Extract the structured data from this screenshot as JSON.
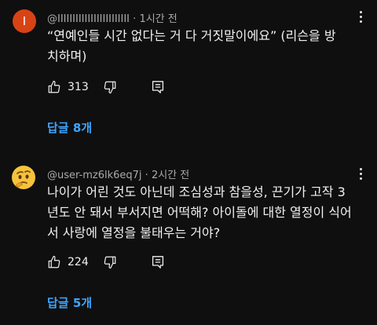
{
  "comments": [
    {
      "avatar_letter": "I",
      "avatar_color": "#d84315",
      "username": "@IIIIIIIIIIIIIIIIIIIIIIII",
      "separator": "·",
      "time": "1시간 전",
      "text_line1": "“연예인들 시간 없다는 거 다 거짓말이에요”   (리슨을 방",
      "text_line2": "치하며)",
      "likes": "313",
      "replies_label": "답글 8개"
    },
    {
      "avatar_icon": "thinking-face-emoji",
      "username": "@user-mz6lk6eq7j",
      "separator": "·",
      "time": "2시간 전",
      "text_line1": "나이가 어린 것도 아닌데 조심성과 참을성, 끈기가 고작 3",
      "text_line2": "년도 안 돼서 부서지면 어떡해? 아이돌에 대한 열정이 식어",
      "text_line3": "서 사랑에 열정을 불태우는 거야?",
      "likes": "224",
      "replies_label": "답글 5개"
    }
  ],
  "colors": {
    "background": "#0f0f0f",
    "text": "#f1f1f1",
    "meta": "#aaaaaa",
    "link": "#3ea6ff"
  }
}
